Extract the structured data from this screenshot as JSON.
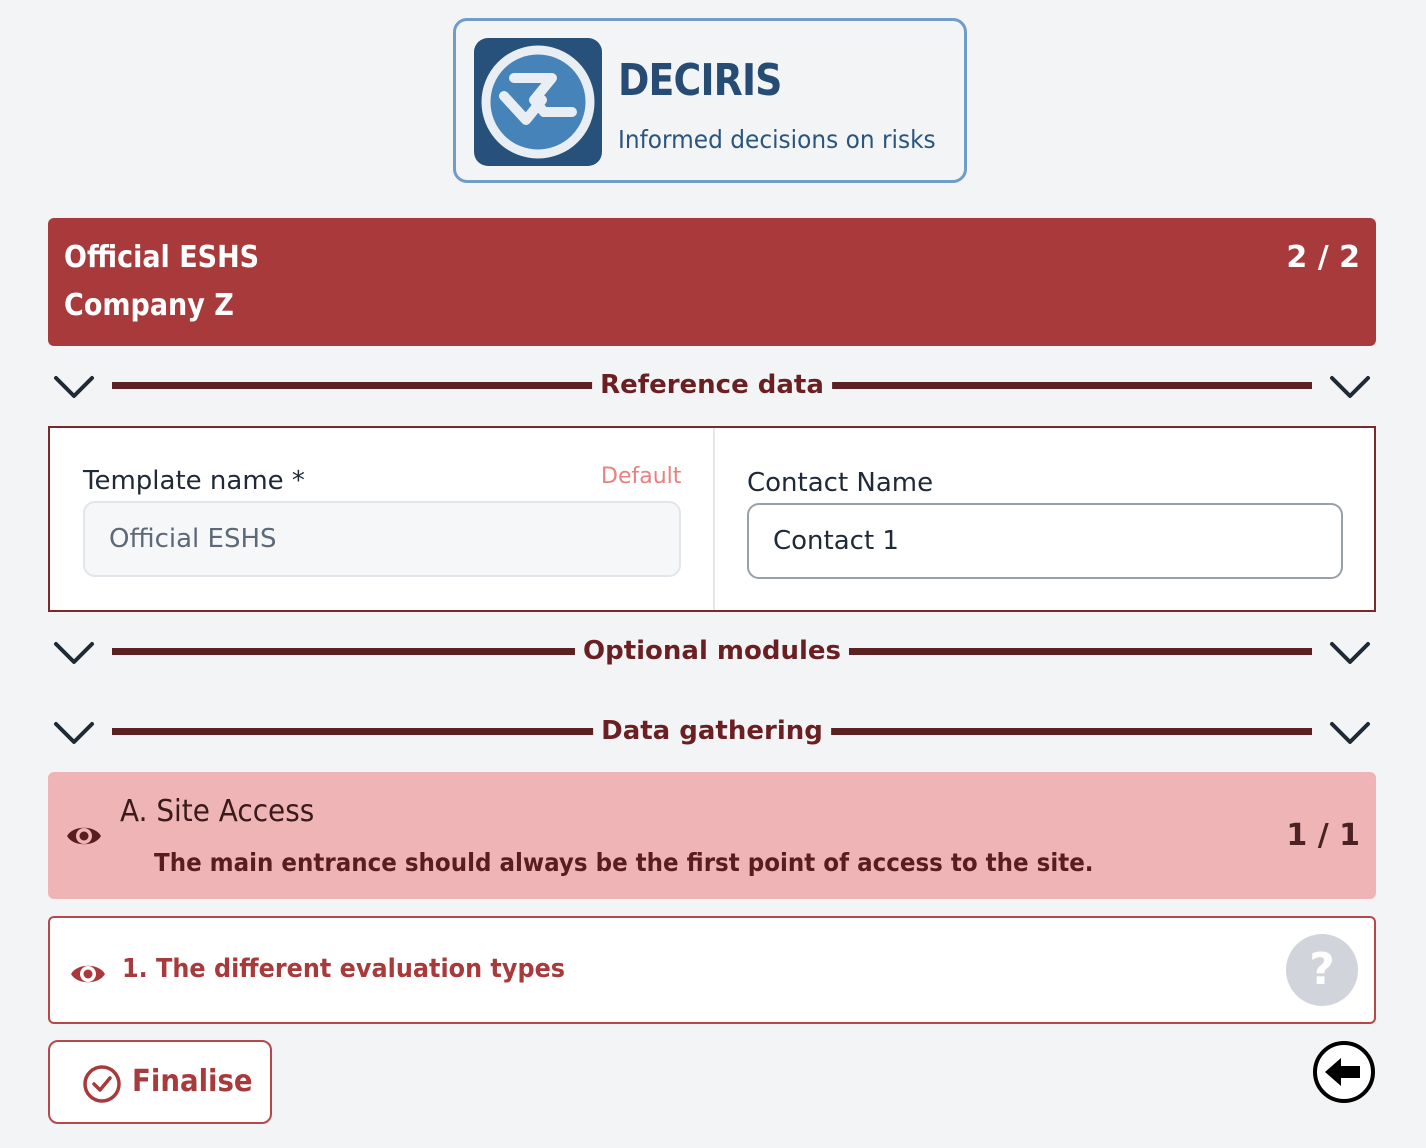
{
  "brand": {
    "name": "DECIRIS",
    "tagline": "Informed decisions on risks",
    "colors": {
      "primary": "#27507a",
      "accent": "#a83a3c"
    }
  },
  "header": {
    "title": "Official ESHS",
    "company": "Company Z",
    "page_counter": "2 / 2"
  },
  "sections": {
    "reference": "Reference data",
    "optional": "Optional modules",
    "gathering": "Data gathering"
  },
  "reference_data": {
    "template_name": {
      "label": "Template name *",
      "badge": "Default",
      "value": "Official ESHS"
    },
    "contact_name": {
      "label": "Contact Name",
      "value": "Contact 1"
    }
  },
  "module": {
    "title": "A. Site Access",
    "description": "The main entrance should always be the first point of access to the site.",
    "counter": "1 / 1"
  },
  "question": {
    "text": "1. The different evaluation types",
    "help_symbol": "?"
  },
  "actions": {
    "finalise_label": "Finalise"
  },
  "icons": [
    "deciris-logo-icon",
    "chevron-down-icon",
    "eye-icon",
    "question-icon",
    "check-circle-icon",
    "back-arrow-icon"
  ]
}
